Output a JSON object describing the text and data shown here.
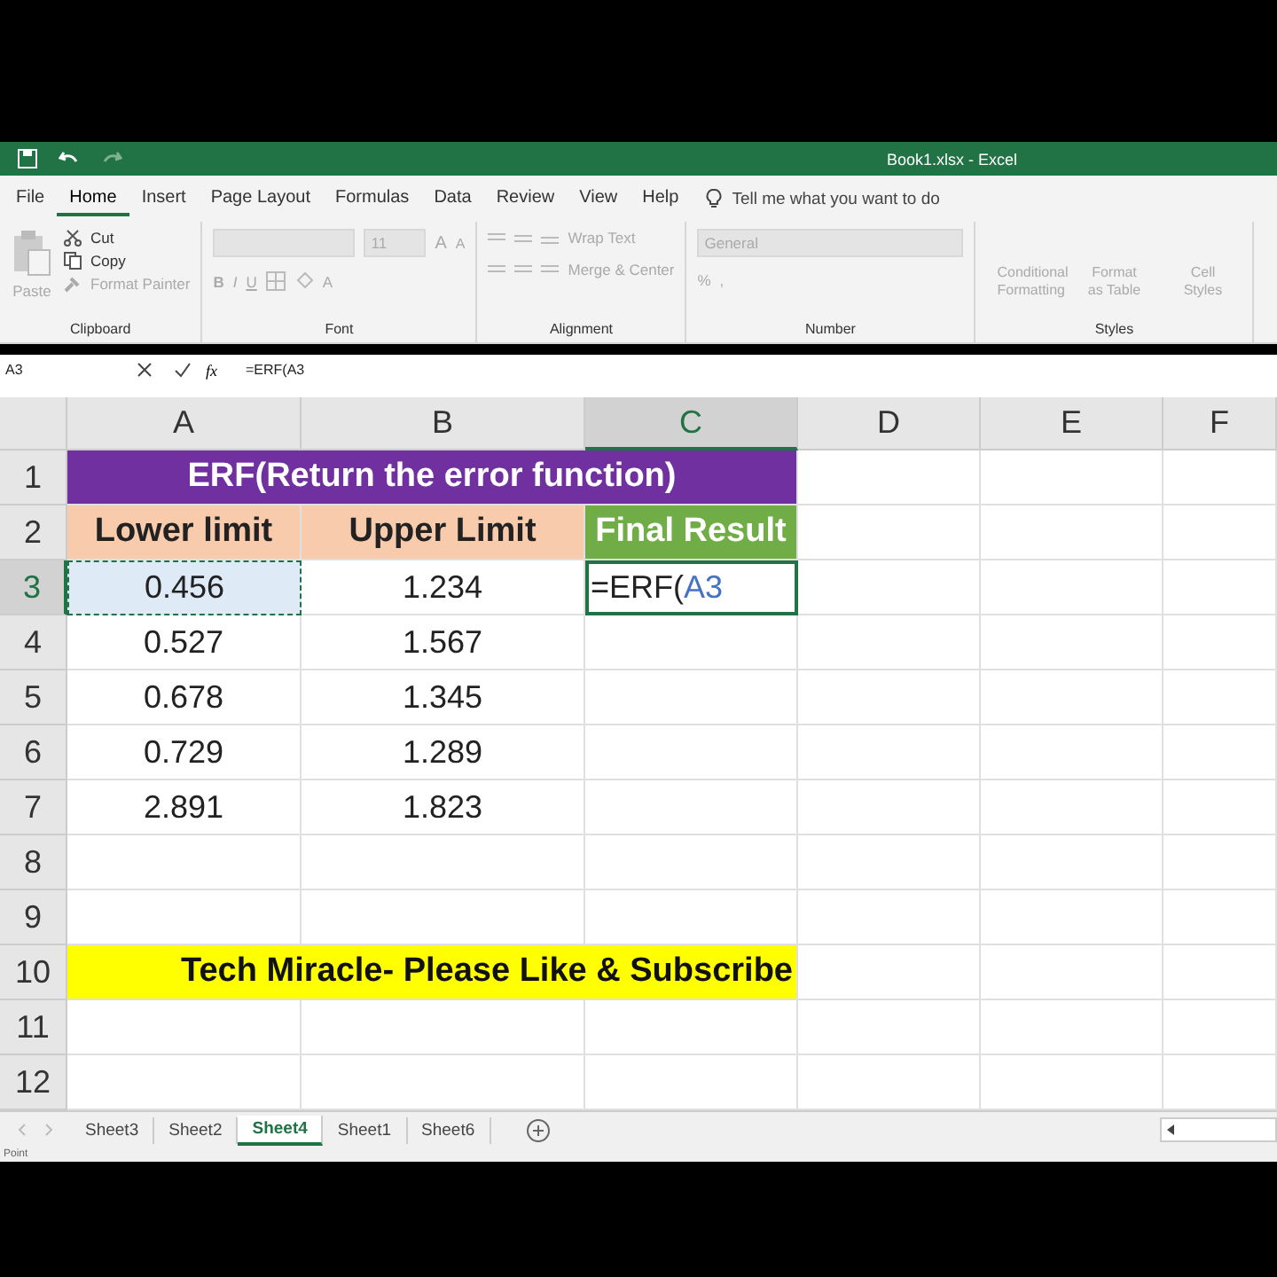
{
  "window": {
    "title": "Book1.xlsx  -  Excel"
  },
  "menu": [
    {
      "label": "File",
      "selected": false
    },
    {
      "label": "Home",
      "selected": true
    },
    {
      "label": "Insert",
      "selected": false
    },
    {
      "label": "Page Layout",
      "selected": false
    },
    {
      "label": "Formulas",
      "selected": false
    },
    {
      "label": "Data",
      "selected": false
    },
    {
      "label": "Review",
      "selected": false
    },
    {
      "label": "View",
      "selected": false
    },
    {
      "label": "Help",
      "selected": false
    }
  ],
  "tell_me": {
    "placeholder": "Tell me what you want to do"
  },
  "ribbon": {
    "clipboard": {
      "label": "Clipboard",
      "paste": "Paste",
      "cut": "Cut",
      "copy": "Copy",
      "format_painter": "Format Painter"
    },
    "font": {
      "label": "Font",
      "size": "11",
      "bold": "B",
      "italic": "I",
      "underline": "U",
      "grow": "A",
      "shrink": "A",
      "font_tint": "A"
    },
    "alignment": {
      "label": "Alignment",
      "wrap": "Wrap Text",
      "merge": "Merge & Center"
    },
    "number": {
      "label": "Number",
      "format": "General",
      "percent": "%",
      "comma": ","
    },
    "styles": {
      "label": "Styles",
      "buttons": [
        "Conditional Formatting",
        "Format as Table",
        "Cell Styles"
      ]
    }
  },
  "formula_bar": {
    "name_box": "A3",
    "fx": "fx",
    "formula": "=ERF(A3"
  },
  "sheet": {
    "columns": [
      {
        "label": "A",
        "selected": false
      },
      {
        "label": "B",
        "selected": false
      },
      {
        "label": "C",
        "selected": true
      },
      {
        "label": "D",
        "selected": false
      },
      {
        "label": "E",
        "selected": false
      },
      {
        "label": "F",
        "selected": false
      }
    ],
    "rows": [
      {
        "label": "1",
        "selected": false,
        "cells": [
          {
            "kind": "title",
            "text": "ERF(Return the error function)"
          }
        ]
      },
      {
        "label": "2",
        "selected": false,
        "cells": [
          {
            "kind": "header",
            "text": "Lower limit"
          },
          {
            "kind": "header",
            "text": "Upper Limit"
          },
          {
            "kind": "result-header",
            "text": "Final Result"
          }
        ]
      },
      {
        "label": "3",
        "selected": true,
        "cells": [
          {
            "kind": "referenced",
            "text": "0.456"
          },
          {
            "kind": "value",
            "text": "1.234"
          },
          {
            "kind": "editing",
            "text": "=ERF(",
            "reference": "A3"
          }
        ]
      },
      {
        "label": "4",
        "selected": false,
        "cells": [
          {
            "kind": "value",
            "text": "0.527"
          },
          {
            "kind": "value",
            "text": "1.567"
          }
        ]
      },
      {
        "label": "5",
        "selected": false,
        "cells": [
          {
            "kind": "value",
            "text": "0.678"
          },
          {
            "kind": "value",
            "text": "1.345"
          }
        ]
      },
      {
        "label": "6",
        "selected": false,
        "cells": [
          {
            "kind": "value",
            "text": "0.729"
          },
          {
            "kind": "value",
            "text": "1.289"
          }
        ]
      },
      {
        "label": "7",
        "selected": false,
        "cells": [
          {
            "kind": "value",
            "text": "2.891"
          },
          {
            "kind": "value",
            "text": "1.823"
          }
        ]
      },
      {
        "label": "8",
        "selected": false,
        "cells": []
      },
      {
        "label": "9",
        "selected": false,
        "cells": []
      },
      {
        "label": "10",
        "selected": false,
        "cells": [
          {
            "kind": "banner",
            "text": "Tech Miracle- Please Like & Subscribe"
          }
        ]
      },
      {
        "label": "11",
        "selected": false,
        "cells": []
      },
      {
        "label": "12",
        "selected": false,
        "cells": []
      }
    ]
  },
  "sheet_tabs": [
    {
      "label": "Sheet3",
      "selected": false
    },
    {
      "label": "Sheet2",
      "selected": false
    },
    {
      "label": "Sheet4",
      "selected": true
    },
    {
      "label": "Sheet1",
      "selected": false
    },
    {
      "label": "Sheet6",
      "selected": false
    }
  ],
  "status_bar": {
    "mode": "Point"
  }
}
